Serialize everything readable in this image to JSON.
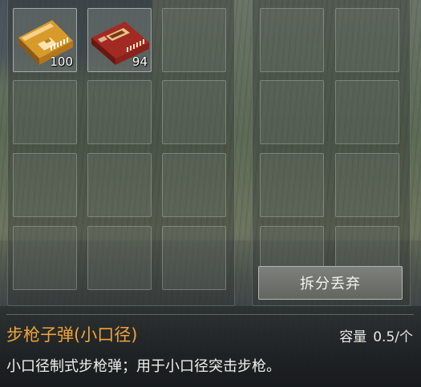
{
  "inventory": {
    "left_grid": {
      "rows": 4,
      "cols": 3,
      "items": [
        {
          "name": "步枪子弹(小口径)",
          "icon": "rifle-ammo-box-yellow-icon",
          "count": "100"
        },
        {
          "name": "red-ammo-box",
          "icon": "ammo-box-red-icon",
          "count": "94"
        }
      ]
    },
    "right_grid": {
      "rows": 4,
      "cols": 2
    },
    "drop_button_label": "拆分丢弃"
  },
  "selected_item": {
    "name": "步枪子弹(小口径)",
    "capacity_label": "容量",
    "capacity_value": "0.5/个",
    "description": "小口径制式步枪弹；用于小口径突击步枪。"
  },
  "colors": {
    "item_name": "#f0a33a",
    "text": "#f0f0ec"
  }
}
